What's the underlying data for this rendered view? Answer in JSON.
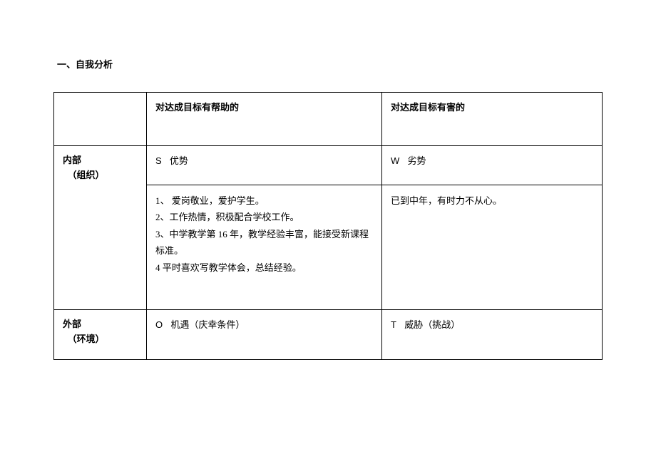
{
  "title": "一、自我分析",
  "headers": {
    "helpful": "对达成目标有帮助的",
    "harmful": "对达成目标有害的"
  },
  "internal": {
    "label_line1": "内部",
    "label_line2": "（组织）",
    "s_letter": "S",
    "s_label": "优势",
    "w_letter": "W",
    "w_label": "劣势",
    "strengths": "1、 爱岗敬业，爱护学生。\n2、工作热情，积极配合学校工作。\n3、中学教学第 16 年，教学经验丰富，能接受新课程标准。\n4 平时喜欢写教学体会，总结经验。",
    "weaknesses": "已到中年，有时力不从心。"
  },
  "external": {
    "label_line1": "外部",
    "label_line2": "（环境）",
    "o_letter": "O",
    "o_label": "机遇（庆幸条件）",
    "t_letter": "T",
    "t_label": "威胁（挑战）"
  }
}
